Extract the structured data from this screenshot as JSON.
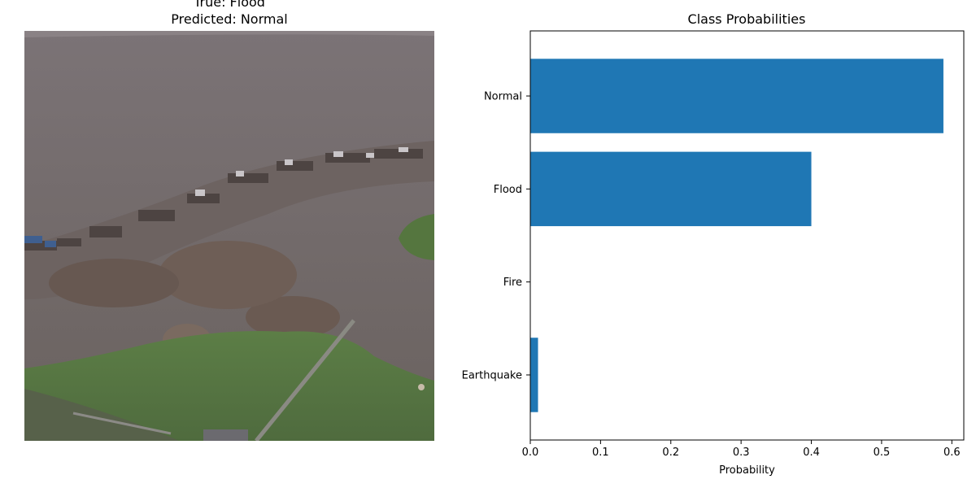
{
  "image_panel": {
    "true_label": "True: Flood",
    "predicted_label": "Predicted: Normal",
    "image_description_icon": "aerial-flood-photo"
  },
  "chart_data": {
    "type": "bar",
    "orientation": "horizontal",
    "title": "Class Probabilities",
    "xlabel": "Probability",
    "ylabel": "",
    "categories": [
      "Earthquake",
      "Fire",
      "Flood",
      "Normal"
    ],
    "values": [
      0.011,
      0.0,
      0.4,
      0.588
    ],
    "xlim": [
      0,
      0.617
    ],
    "xticks": [
      "0.0",
      "0.1",
      "0.2",
      "0.3",
      "0.4",
      "0.5",
      "0.6"
    ],
    "grid": false,
    "bar_color": "#1f77b4"
  }
}
